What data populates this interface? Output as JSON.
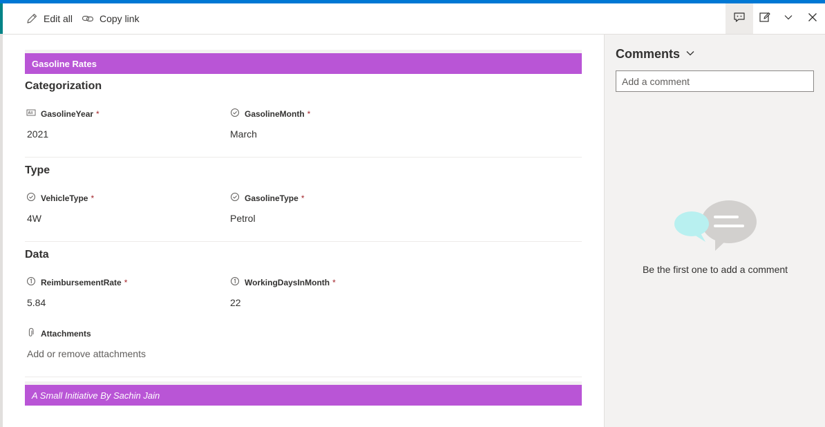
{
  "toolbar": {
    "edit_all": "Edit all",
    "copy_link": "Copy link"
  },
  "form": {
    "header": "Gasoline Rates",
    "footer": "A Small Initiative By Sachin Jain",
    "required_marker": "*",
    "sections": {
      "categorization": {
        "title": "Categorization",
        "gasoline_year": {
          "label": "GasolineYear",
          "value": "2021"
        },
        "gasoline_month": {
          "label": "GasolineMonth",
          "value": "March"
        }
      },
      "type": {
        "title": "Type",
        "vehicle_type": {
          "label": "VehicleType",
          "value": "4W"
        },
        "gasoline_type": {
          "label": "GasolineType",
          "value": "Petrol"
        }
      },
      "data": {
        "title": "Data",
        "reimbursement_rate": {
          "label": "ReimbursementRate",
          "value": "5.84"
        },
        "working_days": {
          "label": "WorkingDaysInMonth",
          "value": "22"
        }
      }
    },
    "attachments": {
      "label": "Attachments",
      "action": "Add or remove attachments"
    }
  },
  "comments": {
    "title": "Comments",
    "placeholder": "Add a comment",
    "empty_text": "Be the first one to add a comment"
  },
  "colors": {
    "accent": "#0078d4",
    "header_band": "#b955d6",
    "bubble_cyan": "#b8f0f0",
    "bubble_gray": "#d2d0ce"
  },
  "icons": {
    "edit": "pencil-icon",
    "copy": "link-icon",
    "text_field": "text-field-icon",
    "choice_field": "choice-icon",
    "number_field": "number-icon",
    "attachment": "paperclip-icon",
    "comment_toggle": "comment-icon",
    "edit_form": "edit-form-icon",
    "more": "chevron-down-icon",
    "close": "close-icon"
  }
}
